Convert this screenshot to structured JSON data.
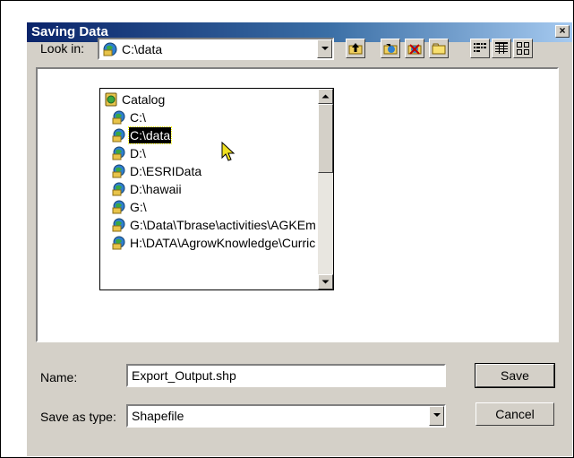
{
  "dialog": {
    "title": "Saving Data",
    "close_glyph": "×"
  },
  "look_in": {
    "label": "Look in:",
    "value": "C:\\data"
  },
  "toolbar": {
    "buttons": [
      "up-one-level-icon",
      "connect-folder-icon",
      "disconnect-folder-icon",
      "new-folder-icon",
      "list-view-icon",
      "details-view-icon",
      "thumbnails-view-icon"
    ]
  },
  "dropdown": {
    "items": [
      {
        "label": "Catalog",
        "icon": "catalog-icon",
        "indent": 0
      },
      {
        "label": "C:\\",
        "icon": "folder-connection-icon",
        "indent": 1
      },
      {
        "label": "C:\\data",
        "icon": "folder-connection-icon",
        "indent": 1,
        "selected": true
      },
      {
        "label": "D:\\",
        "icon": "folder-connection-icon",
        "indent": 1
      },
      {
        "label": "D:\\ESRIData",
        "icon": "folder-connection-icon",
        "indent": 1
      },
      {
        "label": "D:\\hawaii",
        "icon": "folder-connection-icon",
        "indent": 1
      },
      {
        "label": "G:\\",
        "icon": "folder-connection-icon",
        "indent": 1
      },
      {
        "label": "G:\\Data\\Tbrase\\activities\\AGKEm",
        "icon": "folder-connection-icon",
        "indent": 1
      },
      {
        "label": "H:\\DATA\\AgrowKnowledge\\Curric",
        "icon": "folder-connection-icon",
        "indent": 1
      }
    ]
  },
  "name": {
    "label": "Name:",
    "value": "Export_Output.shp"
  },
  "save_as_type": {
    "label": "Save as type:",
    "value": "Shapefile"
  },
  "buttons": {
    "save": "Save",
    "cancel": "Cancel"
  },
  "colors": {
    "titlebar_start": "#0a246a",
    "titlebar_end": "#a6caf0",
    "dialog_bg": "#d4d0c8",
    "selection": "#000000"
  }
}
